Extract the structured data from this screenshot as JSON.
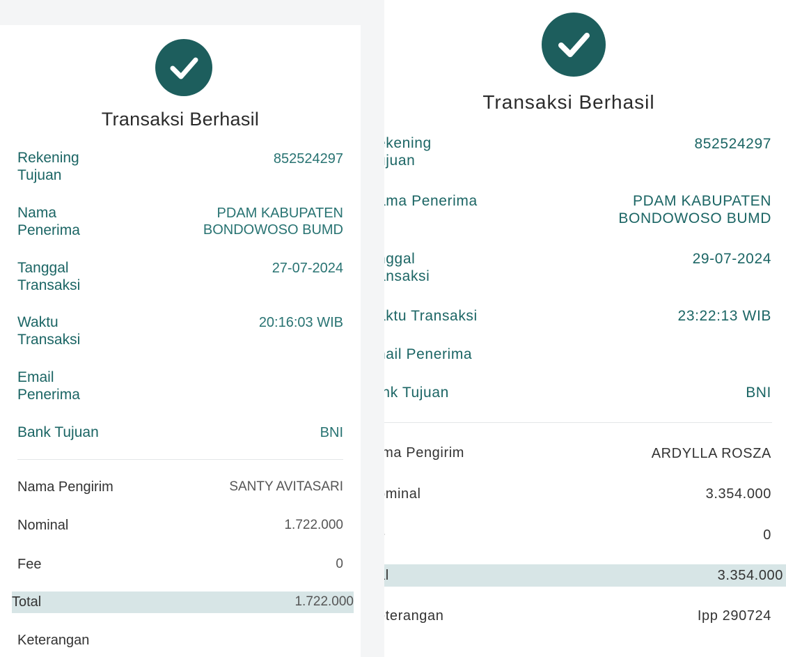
{
  "left": {
    "title": "Transaksi Berhasil",
    "rekening_tujuan": {
      "label_line1": "Rekening",
      "label_line2": "Tujuan",
      "value": "852524297"
    },
    "nama_penerima": {
      "label_line1": "Nama",
      "label_line2": "Penerima",
      "value_line1": "PDAM KABUPATEN",
      "value_line2": "BONDOWOSO BUMD"
    },
    "tanggal_transaksi": {
      "label_line1": "Tanggal",
      "label_line2": "Transaksi",
      "value": "27-07-2024"
    },
    "waktu_transaksi": {
      "label_line1": "Waktu",
      "label_line2": "Transaksi",
      "value": "20:16:03 WIB"
    },
    "email_penerima": {
      "label_line1": "Email",
      "label_line2": "Penerima",
      "value": ""
    },
    "bank_tujuan": {
      "label": "Bank Tujuan",
      "value": "BNI"
    },
    "nama_pengirim": {
      "label": "Nama Pengirim",
      "value": "SANTY AVITASARI"
    },
    "nominal": {
      "label": "Nominal",
      "value": "1.722.000"
    },
    "fee": {
      "label": "Fee",
      "value": "0"
    },
    "total": {
      "label": "Total",
      "value": "1.722.000"
    },
    "keterangan": {
      "label": "Keterangan",
      "value": ""
    }
  },
  "right": {
    "title": "Transaksi Berhasil",
    "rekening_tujuan": {
      "label_line1": "ekening",
      "label_line2": "ujuan",
      "value": "852524297"
    },
    "nama_penerima": {
      "label": "ama Penerima",
      "value_line1": "PDAM KABUPATEN",
      "value_line2": "BONDOWOSO BUMD"
    },
    "tanggal_transaksi": {
      "label_line1": "nggal",
      "label_line2": "ansaksi",
      "value": "29-07-2024"
    },
    "waktu_transaksi": {
      "label": "aktu Transaksi",
      "value": "23:22:13 WIB"
    },
    "email_penerima": {
      "label": "nail Penerima",
      "value": ""
    },
    "bank_tujuan": {
      "label": "ınk Tujuan",
      "value": "BNI"
    },
    "nama_pengirim": {
      "label": "ıma Pengirim",
      "value": "ARDYLLA ROSZA"
    },
    "nominal": {
      "label": "ominal",
      "value": "3.354.000"
    },
    "fee": {
      "label": "e",
      "value": "0"
    },
    "total": {
      "label": "al",
      "value": "3.354.000"
    },
    "keterangan": {
      "label": "eterangan",
      "value": "Ipp 290724"
    }
  },
  "icons": {
    "success": "check-circle-icon"
  },
  "colors": {
    "accent": "#1d5e5d",
    "label_teal": "#1b6564",
    "total_bg": "#d7e5e6"
  }
}
